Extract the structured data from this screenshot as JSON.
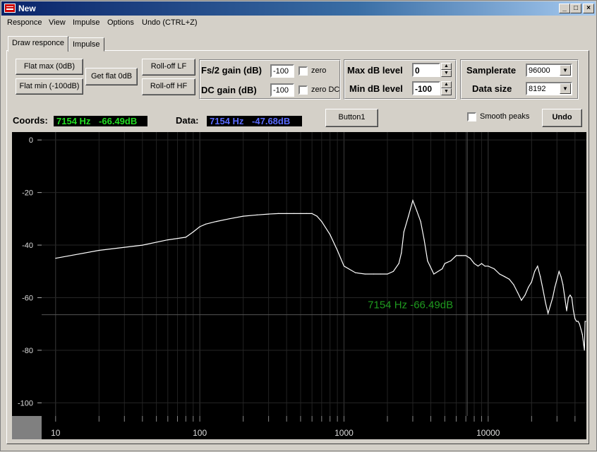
{
  "window": {
    "title": "New"
  },
  "menu": [
    "Responce",
    "View",
    "Impulse",
    "Options",
    "Undo (CTRL+Z)"
  ],
  "tabs": [
    "Draw responce",
    "Impulse"
  ],
  "buttons": {
    "flat_max": "Flat max (0dB)",
    "flat_min": "Flat min (-100dB)",
    "get_flat": "Get flat 0dB",
    "rolloff_lf": "Roll-off LF",
    "rolloff_hf": "Roll-off HF",
    "button1": "Button1",
    "undo": "Undo"
  },
  "gain": {
    "fs2_label": "Fs/2 gain (dB)",
    "fs2_value": "-100",
    "fs2_zero_label": "zero",
    "dc_label": "DC gain (dB)",
    "dc_value": "-100",
    "dc_zero_label": "zero DC"
  },
  "levels": {
    "max_label": "Max dB level",
    "max_value": "0",
    "min_label": "Min dB level",
    "min_value": "-100"
  },
  "settings": {
    "samplerate_label": "Samplerate",
    "samplerate_value": "96000",
    "datasize_label": "Data size",
    "datasize_value": "8192"
  },
  "status": {
    "coords_label": "Coords:",
    "coords_hz": "7154 Hz",
    "coords_db": "-66.49dB",
    "data_label": "Data:",
    "data_hz": "7154 Hz",
    "data_db": "-47.68dB",
    "smooth_label": "Smooth peaks",
    "cursor_text": "7154 Hz   -66.49dB"
  },
  "colors": {
    "coords_fg": "#22dd22",
    "data_fg": "#5a6bff",
    "plot_bg": "#000000",
    "curve": "#ffffff",
    "cursor_text": "#1f9a1f"
  },
  "chart_data": {
    "type": "line",
    "x_scale": "log",
    "xlim": [
      8,
      48000
    ],
    "ylim": [
      -105,
      3
    ],
    "y_ticks": [
      0,
      -20,
      -40,
      -60,
      -80,
      -100
    ],
    "y_tick_labels": [
      "0",
      "-20",
      "-40",
      "-60",
      "-80",
      "-100"
    ],
    "x_tick_labels": [
      {
        "x": 10,
        "label": "10"
      },
      {
        "x": 100,
        "label": "100"
      },
      {
        "x": 1000,
        "label": "1000"
      },
      {
        "x": 10000,
        "label": "10000"
      }
    ],
    "cursor": {
      "x": 7154,
      "y": -66.49
    },
    "series": [
      {
        "x": [
          10,
          20,
          40,
          60,
          80,
          90,
          100,
          110,
          130,
          160,
          200,
          250,
          300,
          350,
          400,
          450,
          500,
          550,
          600,
          650,
          700,
          800,
          900,
          1000,
          1200,
          1400,
          1600,
          1800,
          2000,
          2200,
          2400,
          2500,
          2600,
          2800,
          3000,
          3200,
          3400,
          3600,
          3800,
          4200,
          4800,
          5000,
          5500,
          6000,
          6500,
          7000,
          7500,
          8000,
          8500,
          9000,
          9500,
          10000,
          11000,
          12000,
          13000,
          14000,
          15000,
          16000,
          17000,
          18000,
          19000,
          20000,
          21000,
          22000,
          23000,
          24000,
          25000,
          26000,
          27000,
          28000,
          29000,
          30000,
          31000,
          32000,
          33000,
          34000,
          35000,
          36000,
          37000,
          38000,
          39000,
          40000,
          41000,
          42000,
          43000,
          44000,
          45000,
          46000,
          46500,
          47000,
          47500
        ],
        "y": [
          -45,
          -42,
          -40,
          -38,
          -37,
          -35,
          -33,
          -32,
          -31,
          -30,
          -29,
          -28.5,
          -28.2,
          -28,
          -28,
          -28,
          -28,
          -28,
          -28,
          -29,
          -31,
          -36,
          -42,
          -48,
          -50.5,
          -51,
          -51,
          -51,
          -51,
          -50,
          -47,
          -43,
          -35,
          -29,
          -23,
          -27,
          -31,
          -38,
          -46,
          -51,
          -49,
          -47,
          -46,
          -44,
          -44,
          -44,
          -45,
          -47,
          -48,
          -47,
          -48,
          -48,
          -49,
          -51,
          -52,
          -53,
          -55,
          -58,
          -61,
          -59,
          -56,
          -54,
          -50,
          -48,
          -52,
          -57,
          -62,
          -66,
          -63,
          -60,
          -56,
          -53,
          -50,
          -52,
          -55,
          -60,
          -65,
          -60,
          -59,
          -60,
          -65,
          -68,
          -69,
          -69,
          -70,
          -72,
          -74,
          -78,
          -80,
          -69,
          -69
        ]
      }
    ]
  }
}
